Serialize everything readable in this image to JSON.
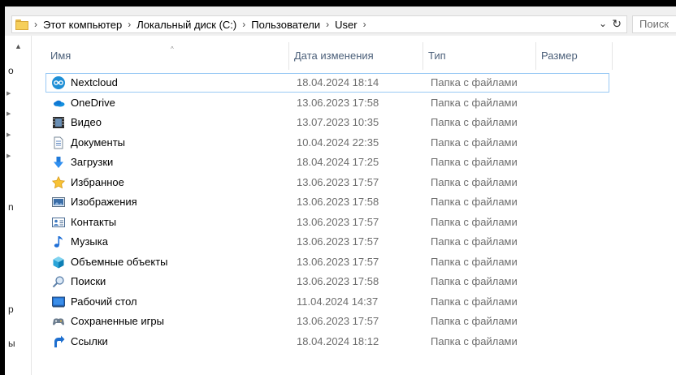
{
  "address": {
    "crumbs": [
      "Этот компьютер",
      "Локальный диск (C:)",
      "Пользователи",
      "User"
    ],
    "search_placeholder": "Поиск"
  },
  "nav_fragments": [
    "o",
    "n",
    "p",
    "ы"
  ],
  "columns": {
    "name": "Имя",
    "date": "Дата изменения",
    "type": "Тип",
    "size": "Размер"
  },
  "rows": [
    {
      "name": "Nextcloud",
      "date": "18.04.2024 18:14",
      "type": "Папка с файлами",
      "icon": "nextcloud-icon"
    },
    {
      "name": "OneDrive",
      "date": "13.06.2023 17:58",
      "type": "Папка с файлами",
      "icon": "onedrive-icon"
    },
    {
      "name": "Видео",
      "date": "13.07.2023 10:35",
      "type": "Папка с файлами",
      "icon": "video-icon"
    },
    {
      "name": "Документы",
      "date": "10.04.2024 22:35",
      "type": "Папка с файлами",
      "icon": "documents-icon"
    },
    {
      "name": "Загрузки",
      "date": "18.04.2024 17:25",
      "type": "Папка с файлами",
      "icon": "downloads-icon"
    },
    {
      "name": "Избранное",
      "date": "13.06.2023 17:57",
      "type": "Папка с файлами",
      "icon": "favorites-icon"
    },
    {
      "name": "Изображения",
      "date": "13.06.2023 17:58",
      "type": "Папка с файлами",
      "icon": "pictures-icon"
    },
    {
      "name": "Контакты",
      "date": "13.06.2023 17:57",
      "type": "Папка с файлами",
      "icon": "contacts-icon"
    },
    {
      "name": "Музыка",
      "date": "13.06.2023 17:57",
      "type": "Папка с файлами",
      "icon": "music-icon"
    },
    {
      "name": "Объемные объекты",
      "date": "13.06.2023 17:57",
      "type": "Папка с файлами",
      "icon": "3d-objects-icon"
    },
    {
      "name": "Поиски",
      "date": "13.06.2023 17:58",
      "type": "Папка с файлами",
      "icon": "searches-icon"
    },
    {
      "name": "Рабочий стол",
      "date": "11.04.2024 14:37",
      "type": "Папка с файлами",
      "icon": "desktop-icon"
    },
    {
      "name": "Сохраненные игры",
      "date": "13.06.2023 17:57",
      "type": "Папка с файлами",
      "icon": "saved-games-icon"
    },
    {
      "name": "Ссылки",
      "date": "18.04.2024 18:12",
      "type": "Папка с файлами",
      "icon": "links-icon"
    }
  ],
  "colors": {
    "header_text": "#4c607a",
    "secondary_text": "#6d6d6d",
    "selection_border": "#99c9f4"
  }
}
